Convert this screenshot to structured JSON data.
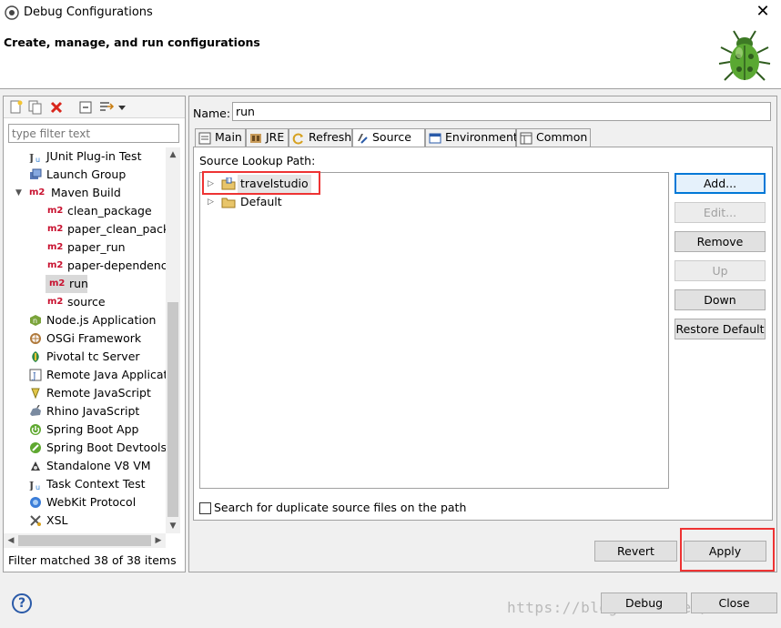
{
  "window": {
    "title": "Debug Configurations",
    "close": "✕"
  },
  "banner": {
    "text": "Create, manage, and run configurations"
  },
  "left": {
    "filter_placeholder": "type filter text",
    "tree": [
      {
        "label": "JUnit Plug-in Test",
        "icon": "junit-plugin-icon",
        "indent": 1
      },
      {
        "label": "Launch Group",
        "icon": "launch-group-icon",
        "indent": 1
      },
      {
        "label": "Maven Build",
        "icon": "maven-icon",
        "indent": 1,
        "expanded": true
      },
      {
        "label": "clean_package",
        "icon": "maven-icon",
        "indent": 2
      },
      {
        "label": "paper_clean_packa",
        "icon": "maven-icon",
        "indent": 2
      },
      {
        "label": "paper_run",
        "icon": "maven-icon",
        "indent": 2
      },
      {
        "label": "paper-dependency",
        "icon": "maven-icon",
        "indent": 2
      },
      {
        "label": "run",
        "icon": "maven-icon",
        "indent": 2,
        "selected": true
      },
      {
        "label": "source",
        "icon": "maven-icon",
        "indent": 2
      },
      {
        "label": "Node.js Application",
        "icon": "nodejs-icon",
        "indent": 1
      },
      {
        "label": "OSGi Framework",
        "icon": "osgi-icon",
        "indent": 1
      },
      {
        "label": "Pivotal tc Server",
        "icon": "pivotal-icon",
        "indent": 1
      },
      {
        "label": "Remote Java Applicati",
        "icon": "remote-java-icon",
        "indent": 1
      },
      {
        "label": "Remote JavaScript",
        "icon": "remote-js-icon",
        "indent": 1
      },
      {
        "label": "Rhino JavaScript",
        "icon": "rhino-icon",
        "indent": 1
      },
      {
        "label": "Spring Boot App",
        "icon": "spring-boot-icon",
        "indent": 1
      },
      {
        "label": "Spring Boot Devtools",
        "icon": "spring-devtools-icon",
        "indent": 1
      },
      {
        "label": "Standalone V8 VM",
        "icon": "v8-icon",
        "indent": 1
      },
      {
        "label": "Task Context Test",
        "icon": "task-context-icon",
        "indent": 1
      },
      {
        "label": "WebKit Protocol",
        "icon": "webkit-icon",
        "indent": 1
      },
      {
        "label": "XSL",
        "icon": "xsl-icon",
        "indent": 1
      }
    ],
    "m2_badge": "m2",
    "status": "Filter matched 38 of 38 items"
  },
  "right": {
    "name_label": "Name:",
    "name_value": "run",
    "tabs": [
      {
        "label": "Main",
        "icon": "main-tab-icon"
      },
      {
        "label": "JRE",
        "icon": "jre-tab-icon"
      },
      {
        "label": "Refresh",
        "icon": "refresh-tab-icon"
      },
      {
        "label": "Source",
        "icon": "source-tab-icon",
        "active": true
      },
      {
        "label": "Environment",
        "icon": "environment-tab-icon"
      },
      {
        "label": "Common",
        "icon": "common-tab-icon"
      }
    ],
    "source_lookup_label": "Source Lookup Path:",
    "lookup_items": [
      {
        "label": "travelstudio",
        "selected": true
      },
      {
        "label": "Default"
      }
    ],
    "buttons": {
      "add": "Add...",
      "edit": "Edit...",
      "remove": "Remove",
      "up": "Up",
      "down": "Down",
      "restore": "Restore Default"
    },
    "duplicate_label": "Search for duplicate source files on the path",
    "revert": "Revert",
    "apply": "Apply"
  },
  "footer": {
    "help": "?",
    "debug": "Debug",
    "close": "Close",
    "watermark": "https://blog.csdn.net/hohoihh"
  },
  "colors": {
    "accent": "#0078d7",
    "highlight": "#ee3333",
    "maven_red": "#c8102e"
  }
}
